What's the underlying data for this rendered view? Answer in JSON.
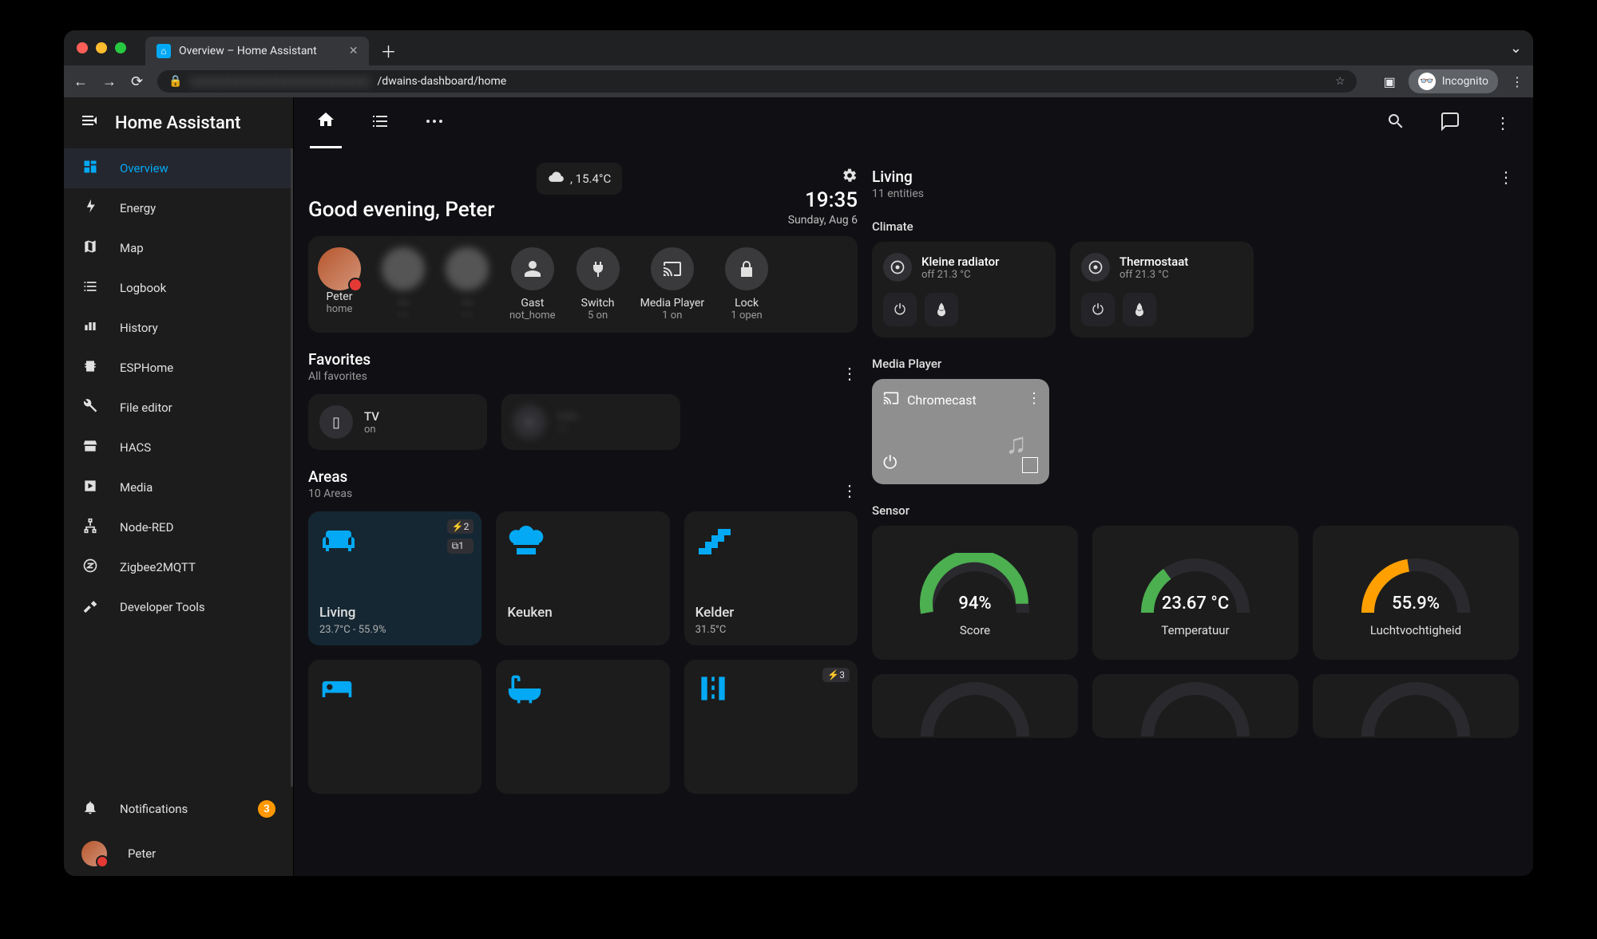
{
  "browser": {
    "tab_title": "Overview – Home Assistant",
    "url_path": "/dwains-dashboard/home",
    "incognito_label": "Incognito"
  },
  "app": {
    "title": "Home Assistant"
  },
  "sidebar": {
    "items": [
      {
        "label": "Overview",
        "icon": "dashboard"
      },
      {
        "label": "Energy",
        "icon": "bolt"
      },
      {
        "label": "Map",
        "icon": "map"
      },
      {
        "label": "Logbook",
        "icon": "logbook"
      },
      {
        "label": "History",
        "icon": "history"
      },
      {
        "label": "ESPHome",
        "icon": "chip"
      },
      {
        "label": "File editor",
        "icon": "wrench"
      },
      {
        "label": "HACS",
        "icon": "store"
      },
      {
        "label": "Media",
        "icon": "media"
      },
      {
        "label": "Node-RED",
        "icon": "sitemap"
      },
      {
        "label": "Zigbee2MQTT",
        "icon": "zigbee"
      },
      {
        "label": "Developer Tools",
        "icon": "hammer"
      }
    ],
    "notifications_label": "Notifications",
    "notifications_count": "3",
    "user_label": "Peter"
  },
  "header": {
    "temp": ", 15.4°C",
    "greeting": "Good evening, Peter",
    "time": "19:35",
    "date": "Sunday, Aug 6"
  },
  "pillrow": [
    {
      "label": "Peter",
      "sub": "home",
      "icon": "avatar"
    },
    {
      "label": "····",
      "sub": "····",
      "icon": "blur"
    },
    {
      "label": "····",
      "sub": "····",
      "icon": "blur"
    },
    {
      "label": "Gast",
      "sub": "not_home",
      "icon": "person"
    },
    {
      "label": "Switch",
      "sub": "5 on",
      "icon": "plug"
    },
    {
      "label": "Media Player",
      "sub": "1 on",
      "icon": "cast"
    },
    {
      "label": "Lock",
      "sub": "1 open",
      "icon": "lock"
    }
  ],
  "favorites": {
    "title": "Favorites",
    "subtitle": "All favorites",
    "items": [
      {
        "name": "TV",
        "state": "on",
        "icon": "tv"
      },
      {
        "name": "······",
        "state": "····",
        "icon": "blur"
      }
    ]
  },
  "areas": {
    "title": "Areas",
    "subtitle": "10 Areas",
    "cards": [
      {
        "name": "Living",
        "sub": "23.7°C - 55.9%",
        "icon": "sofa",
        "active": true,
        "badges": [
          "⚡2",
          "⧉1"
        ]
      },
      {
        "name": "Keuken",
        "sub": "",
        "icon": "chef",
        "active": false,
        "badges": []
      },
      {
        "name": "Kelder",
        "sub": "31.5°C",
        "icon": "stairs",
        "active": false,
        "badges": []
      },
      {
        "name": "",
        "sub": "",
        "icon": "bed",
        "active": false,
        "badges": []
      },
      {
        "name": "",
        "sub": "",
        "icon": "bath",
        "active": false,
        "badges": []
      },
      {
        "name": "",
        "sub": "",
        "icon": "street",
        "active": false,
        "badges": [
          "⚡3"
        ]
      }
    ]
  },
  "right": {
    "title": "Living",
    "subtitle": "11 entities",
    "climate_label": "Climate",
    "climate": [
      {
        "name": "Kleine radiator",
        "state": "off 21.3 °C"
      },
      {
        "name": "Thermostaat",
        "state": "off 21.3 °C"
      }
    ],
    "media_label": "Media Player",
    "media": {
      "name": "Chromecast"
    },
    "sensor_label": "Sensor",
    "sensors": [
      {
        "value": "94%",
        "label": "Score",
        "fill": 0.94,
        "color": "#4caf50"
      },
      {
        "value": "23.67 °C",
        "label": "Temperatuur",
        "fill": 0.3,
        "color": "#4caf50"
      },
      {
        "value": "55.9%",
        "label": "Luchtvochtigheid",
        "fill": 0.45,
        "color": "#ffa000"
      }
    ]
  }
}
